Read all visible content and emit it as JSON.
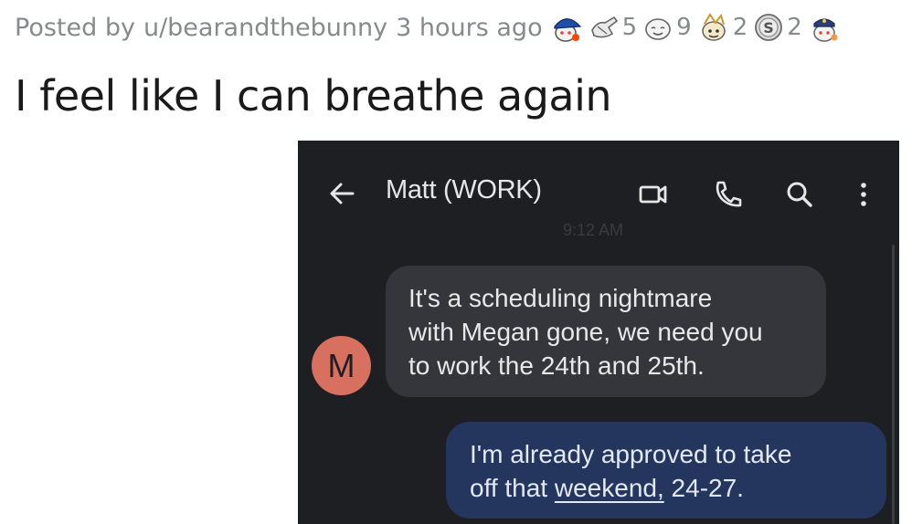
{
  "post": {
    "posted_by_prefix": "Posted by",
    "username": "u/bearandthebunny",
    "time_ago": "3 hours ago",
    "awards": [
      {
        "icon": "blue-cap-snoo-award-icon",
        "count": ""
      },
      {
        "icon": "helping-hand-award-icon",
        "count": "5"
      },
      {
        "icon": "wholesome-award-icon",
        "count": "9"
      },
      {
        "icon": "party-snoo-award-icon",
        "count": "2"
      },
      {
        "icon": "silver-coin-award-icon",
        "count": "2"
      },
      {
        "icon": "captain-snoo-award-icon",
        "count": ""
      }
    ],
    "title": "I feel like I can breathe again"
  },
  "screenshot": {
    "contact_name": "Matt (WORK)",
    "timestamp": "9:12 AM",
    "avatar_letter": "M",
    "incoming": {
      "lines": [
        "It's a scheduling nightmare",
        "with Megan gone, we need you",
        "to work the 24th and 25th."
      ]
    },
    "outgoing": {
      "line1": "I'm already approved to take",
      "line2_pre": "off that ",
      "line2_link": "weekend,",
      "line2_post": " 24-27."
    },
    "colors": {
      "background": "#1e1f23",
      "incoming_bubble": "#34363b",
      "outgoing_bubble": "#24355e",
      "avatar": "#d7705f"
    }
  }
}
